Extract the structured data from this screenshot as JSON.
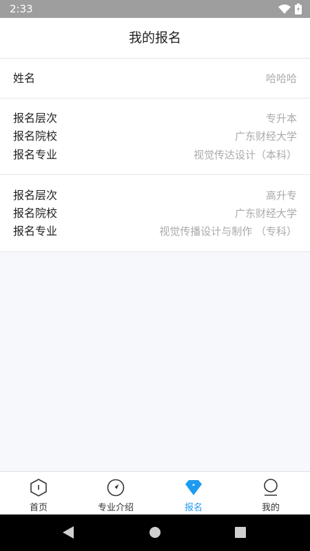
{
  "status_bar": {
    "time": "2:33"
  },
  "header": {
    "title": "我的报名"
  },
  "name_section": {
    "label": "姓名",
    "value": "哈哈哈"
  },
  "registrations": [
    {
      "rows": [
        {
          "label": "报名层次",
          "value": "专升本"
        },
        {
          "label": "报名院校",
          "value": "广东财经大学"
        },
        {
          "label": "报名专业",
          "value": "视觉传达设计（本科）"
        }
      ]
    },
    {
      "rows": [
        {
          "label": "报名层次",
          "value": "高升专"
        },
        {
          "label": "报名院校",
          "value": "广东财经大学"
        },
        {
          "label": "报名专业",
          "value": "视觉传播设计与制作 （专科）"
        }
      ]
    }
  ],
  "bottom_nav": {
    "items": [
      {
        "label": "首页",
        "icon": "hexagon-home-icon",
        "active": false
      },
      {
        "label": "专业介绍",
        "icon": "compass-icon",
        "active": false
      },
      {
        "label": "报名",
        "icon": "diamond-icon",
        "active": true
      },
      {
        "label": "我的",
        "icon": "profile-icon",
        "active": false
      }
    ]
  },
  "colors": {
    "accent": "#1e9bf0",
    "muted_text": "#aaaaaa",
    "status_bar": "#9e9e9e"
  }
}
